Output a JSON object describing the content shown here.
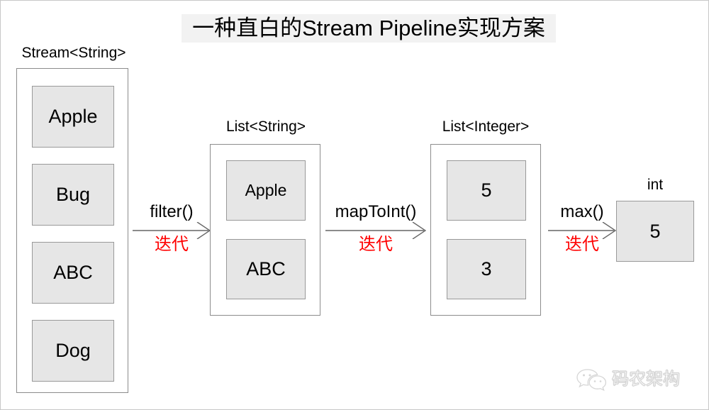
{
  "title": "一种直白的Stream Pipeline实现方案",
  "columns": [
    {
      "caption": "Stream<String>",
      "cells": [
        "Apple",
        "Bug",
        "ABC",
        "Dog"
      ]
    },
    {
      "caption": "List<String>",
      "cells": [
        "Apple",
        "ABC"
      ]
    },
    {
      "caption": "List<Integer>",
      "cells": [
        "5",
        "3"
      ]
    },
    {
      "caption": "int",
      "cells": [
        "5"
      ]
    }
  ],
  "arrows": [
    {
      "operation": "filter()",
      "note": "迭代"
    },
    {
      "operation": "mapToInt()",
      "note": "迭代"
    },
    {
      "operation": "max()",
      "note": "迭代"
    }
  ],
  "watermark": {
    "icon": "wechat-icon",
    "text": "码农架构"
  },
  "colors": {
    "cell_fill": "#e6e6e6",
    "cell_border": "#999999",
    "container_border": "#8c8c8c",
    "title_background": "#f2f2f2",
    "note_text": "#ff0000",
    "text": "#000000"
  }
}
